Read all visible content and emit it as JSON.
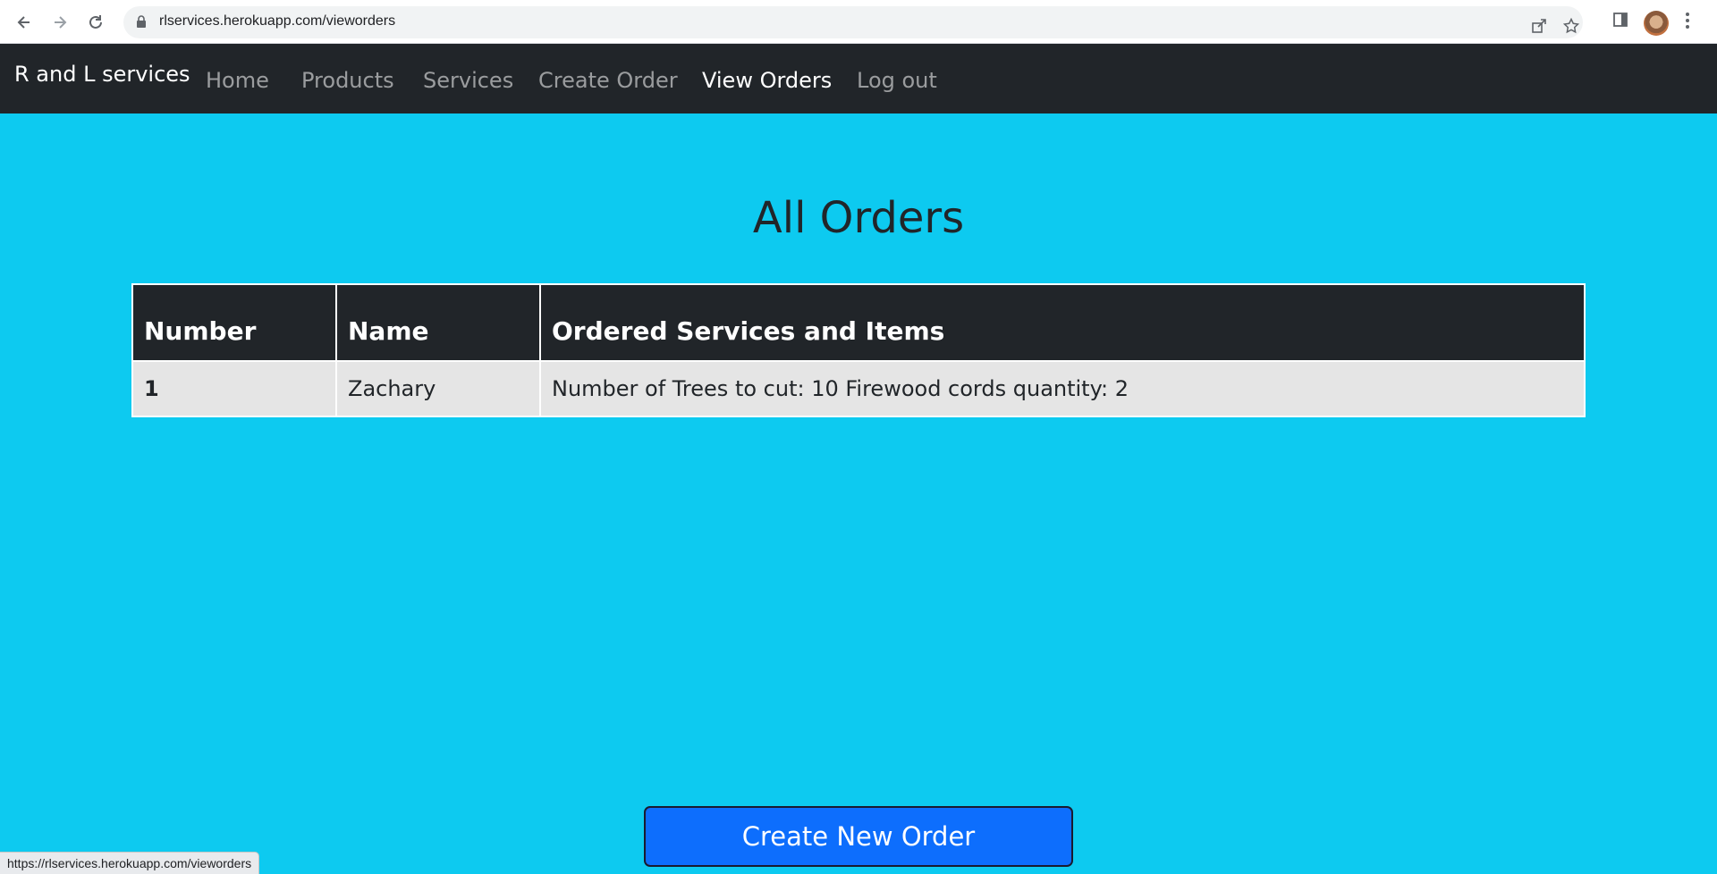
{
  "browser": {
    "url": "rlservices.herokuapp.com/vieworders",
    "status_url": "https://rlservices.herokuapp.com/vieworders"
  },
  "navbar": {
    "brand": "R and L services",
    "links": [
      {
        "label": "Home",
        "active": false
      },
      {
        "label": "Products",
        "active": false
      },
      {
        "label": "Services",
        "active": false
      },
      {
        "label": "Create Order",
        "active": false
      },
      {
        "label": "View Orders",
        "active": true
      },
      {
        "label": "Log out",
        "active": false
      }
    ]
  },
  "main": {
    "title": "All Orders",
    "table": {
      "headers": [
        "Number",
        "Name",
        "Ordered Services and Items"
      ],
      "rows": [
        [
          "1",
          "Zachary",
          "Number of Trees to cut: 10 Firewood cords quantity: 2"
        ]
      ]
    },
    "create_button_label": "Create New Order"
  },
  "colors": {
    "page_background": "#0dcaf0",
    "navbar_background": "#212529",
    "button_primary": "#0d6efd"
  }
}
